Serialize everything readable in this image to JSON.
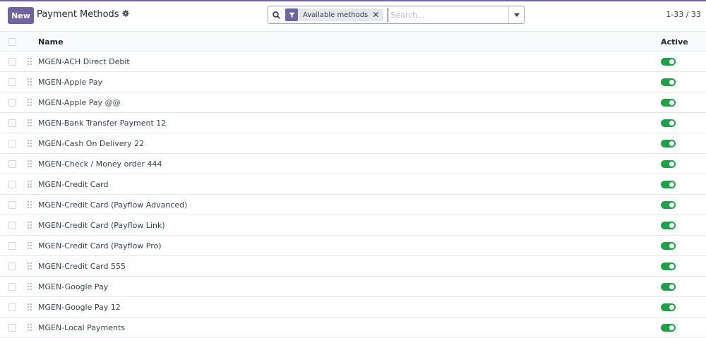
{
  "toolbar": {
    "new_label": "New",
    "title": "Payment Methods",
    "settings_icon": "gear-icon"
  },
  "search": {
    "facet_icon": "filter-icon",
    "facet_label": "Available methods",
    "placeholder": "Search...",
    "value": ""
  },
  "pager": {
    "text": "1-33 / 33"
  },
  "table": {
    "columns": {
      "name": "Name",
      "active": "Active"
    },
    "rows": [
      {
        "name": "MGEN-ACH Direct Debit",
        "active": true
      },
      {
        "name": "MGEN-Apple Pay",
        "active": true
      },
      {
        "name": "MGEN-Apple Pay @@",
        "active": true
      },
      {
        "name": "MGEN-Bank Transfer Payment 12",
        "active": true
      },
      {
        "name": "MGEN-Cash On Delivery 22",
        "active": true
      },
      {
        "name": "MGEN-Check / Money order 444",
        "active": true
      },
      {
        "name": "MGEN-Credit Card",
        "active": true
      },
      {
        "name": "MGEN-Credit Card (Payflow Advanced)",
        "active": true
      },
      {
        "name": "MGEN-Credit Card (Payflow Link)",
        "active": true
      },
      {
        "name": "MGEN-Credit Card (Payflow Pro)",
        "active": true
      },
      {
        "name": "MGEN-Credit Card 555",
        "active": true
      },
      {
        "name": "MGEN-Google Pay",
        "active": true
      },
      {
        "name": "MGEN-Google Pay 12",
        "active": true
      },
      {
        "name": "MGEN-Local Payments",
        "active": true
      }
    ]
  },
  "colors": {
    "brand": "#71639e",
    "toggle_on": "#21a04a"
  }
}
